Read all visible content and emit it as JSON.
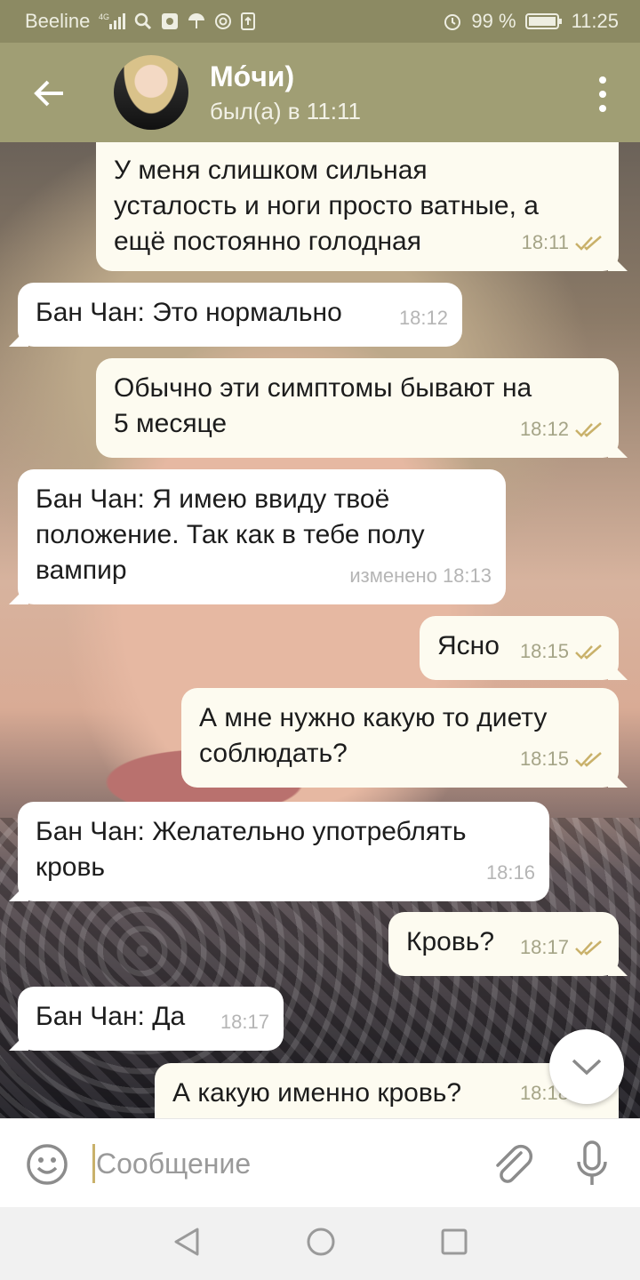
{
  "status_bar": {
    "carrier": "Beeline",
    "network": "4G",
    "battery": "99 %",
    "time": "11:25",
    "icons": [
      "signal-icon",
      "search-icon",
      "gallery-icon",
      "umbrella-icon",
      "at-icon",
      "upload-icon",
      "alarm-icon",
      "battery-icon"
    ]
  },
  "header": {
    "title": "Мо́чи)",
    "subtitle": "был(а) в 11:11"
  },
  "messages": [
    {
      "dir": "out",
      "text": "У меня слишком сильная\nусталость и ноги просто ватные, а\nещё постоянно голодная",
      "time": "18:11",
      "read": true
    },
    {
      "dir": "in",
      "text": "Бан Чан: Это нормально",
      "time": "18:12"
    },
    {
      "dir": "out",
      "text": "Обычно эти симптомы бывают на\n5 месяце",
      "time": "18:12",
      "read": true
    },
    {
      "dir": "in",
      "text": "Бан Чан: Я имею ввиду твоё\nположение. Так как в тебе полу\nвампир",
      "time": "изменено 18:13"
    },
    {
      "dir": "out",
      "text": "Ясно",
      "time": "18:15",
      "read": true
    },
    {
      "dir": "out",
      "text": "А мне нужно какую то диету\nсоблюдать?",
      "time": "18:15",
      "read": true
    },
    {
      "dir": "in",
      "text": "Бан Чан: Желательно употреблять\nкровь",
      "time": "18:16"
    },
    {
      "dir": "out",
      "text": "Кровь?",
      "time": "18:17",
      "read": true
    },
    {
      "dir": "in",
      "text": "Бан Чан: Да",
      "time": "18:17"
    },
    {
      "dir": "out",
      "text": "А какую именно кровь?",
      "time": "18:18",
      "read": true
    }
  ],
  "input": {
    "placeholder": "Сообщение",
    "value": ""
  },
  "colors": {
    "header": "#a09e74",
    "status_bar": "#8c8a63",
    "outgoing_bubble": "#fdfbf0",
    "incoming_bubble": "#ffffff",
    "check_marks": "#c9b16a"
  }
}
